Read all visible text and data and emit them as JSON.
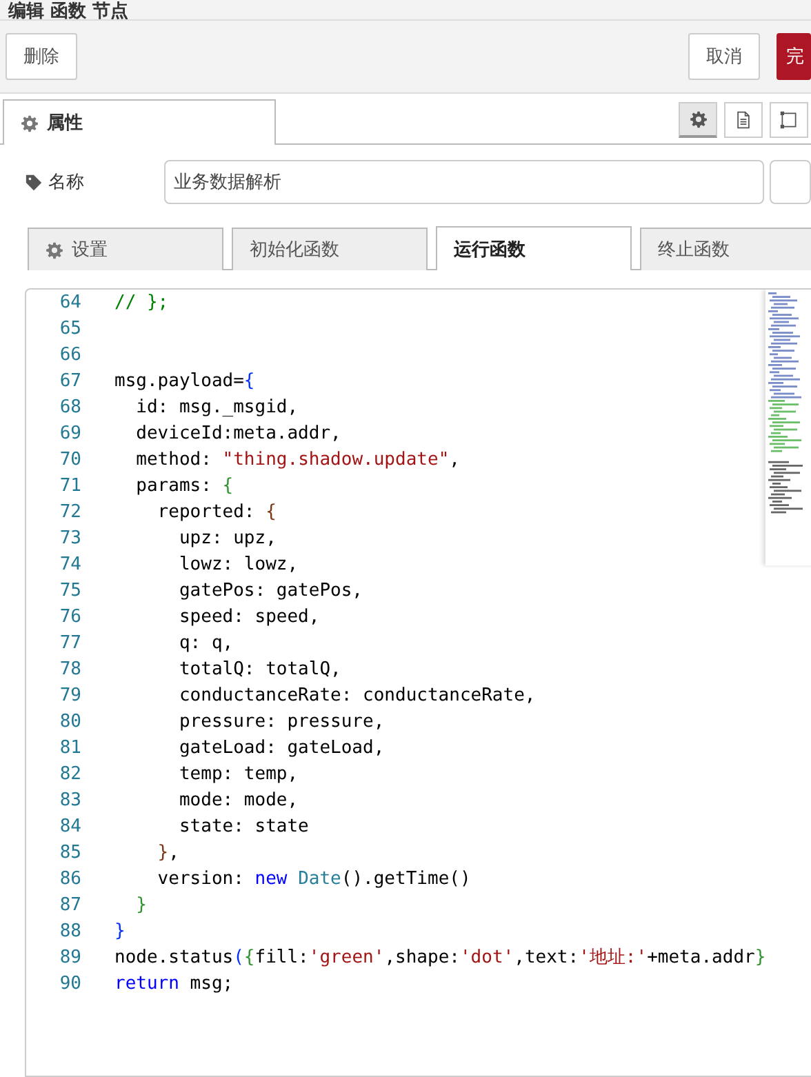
{
  "dialog": {
    "title": "编辑 函数 节点"
  },
  "toolbar": {
    "buttons": [
      {
        "label": "删除",
        "kind": "plain"
      },
      {
        "label": "取消",
        "kind": "plain"
      },
      {
        "label": "完",
        "kind": "primary"
      }
    ]
  },
  "tabs": [
    {
      "label": "属性",
      "selected": true
    }
  ],
  "tab_tools": [
    {
      "kind": "gear",
      "selected": true
    },
    {
      "kind": "doc",
      "selected": false
    },
    {
      "kind": "frame",
      "selected": false
    }
  ],
  "name_field": {
    "label": "名称",
    "value": "业务数据解析"
  },
  "sub_tabs": [
    {
      "label": "设置",
      "kind": "gear",
      "selected": false
    },
    {
      "label": "初始化函数",
      "kind": "plain",
      "selected": false
    },
    {
      "label": "运行函数",
      "kind": "plain",
      "selected": true
    },
    {
      "label": "终止函数",
      "kind": "plain",
      "selected": false
    }
  ],
  "editor": {
    "lines": [
      {
        "number": "64",
        "tokens": [
          {
            "kind": "comment",
            "text": "// };"
          }
        ]
      },
      {
        "number": "65"
      },
      {
        "number": "66"
      },
      {
        "number": "67",
        "tokens": [
          {
            "kind": "plain",
            "text": "msg.payload="
          },
          {
            "kind": "brace",
            "text": "{"
          }
        ]
      },
      {
        "number": "68",
        "tokens": [
          {
            "kind": "plain",
            "text": "  id: msg._msgid,"
          }
        ]
      },
      {
        "number": "69",
        "tokens": [
          {
            "kind": "plain",
            "text": "  deviceId:meta.addr,"
          }
        ]
      },
      {
        "number": "70",
        "tokens": [
          {
            "kind": "plain",
            "text": "  method: "
          },
          {
            "kind": "string",
            "text": "\"thing.shadow.update\""
          },
          {
            "kind": "plain",
            "text": ","
          }
        ]
      },
      {
        "number": "71",
        "tokens": [
          {
            "kind": "plain",
            "text": "  params: "
          },
          {
            "kind": "brace2",
            "text": "{"
          }
        ]
      },
      {
        "number": "72",
        "tokens": [
          {
            "kind": "plain",
            "text": "    reported: "
          },
          {
            "kind": "brace3",
            "text": "{"
          }
        ]
      },
      {
        "number": "73",
        "tokens": [
          {
            "kind": "plain",
            "text": "      upz: upz,"
          }
        ]
      },
      {
        "number": "74",
        "tokens": [
          {
            "kind": "plain",
            "text": "      lowz: lowz,"
          }
        ]
      },
      {
        "number": "75",
        "tokens": [
          {
            "kind": "plain",
            "text": "      gatePos: gatePos,"
          }
        ]
      },
      {
        "number": "76",
        "tokens": [
          {
            "kind": "plain",
            "text": "      speed: speed,"
          }
        ]
      },
      {
        "number": "77",
        "tokens": [
          {
            "kind": "plain",
            "text": "      q: q,"
          }
        ]
      },
      {
        "number": "78",
        "tokens": [
          {
            "kind": "plain",
            "text": "      totalQ: totalQ,"
          }
        ]
      },
      {
        "number": "79",
        "tokens": [
          {
            "kind": "plain",
            "text": "      conductanceRate: conductanceRate,"
          }
        ]
      },
      {
        "number": "80",
        "tokens": [
          {
            "kind": "plain",
            "text": "      pressure: pressure,"
          }
        ]
      },
      {
        "number": "81",
        "tokens": [
          {
            "kind": "plain",
            "text": "      gateLoad: gateLoad,"
          }
        ]
      },
      {
        "number": "82",
        "tokens": [
          {
            "kind": "plain",
            "text": "      temp: temp,"
          }
        ]
      },
      {
        "number": "83",
        "tokens": [
          {
            "kind": "plain",
            "text": "      mode: mode,"
          }
        ]
      },
      {
        "number": "84",
        "tokens": [
          {
            "kind": "plain",
            "text": "      state: state"
          }
        ]
      },
      {
        "number": "85",
        "tokens": [
          {
            "kind": "brace3",
            "text": "    }"
          },
          {
            "kind": "plain",
            "text": ","
          }
        ]
      },
      {
        "number": "86",
        "tokens": [
          {
            "kind": "plain",
            "text": "    version: "
          },
          {
            "kind": "keyword",
            "text": "new "
          },
          {
            "kind": "type",
            "text": "Date"
          },
          {
            "kind": "plain",
            "text": "().getTime()"
          }
        ]
      },
      {
        "number": "87",
        "tokens": [
          {
            "kind": "brace2",
            "text": "  }"
          }
        ]
      },
      {
        "number": "88",
        "tokens": [
          {
            "kind": "brace",
            "text": "}"
          }
        ]
      },
      {
        "number": "89",
        "tokens": [
          {
            "kind": "plain",
            "text": "node.status"
          },
          {
            "kind": "brace",
            "text": "("
          },
          {
            "kind": "brace2",
            "text": "{"
          },
          {
            "kind": "plain",
            "text": "fill:"
          },
          {
            "kind": "string",
            "text": "'green'"
          },
          {
            "kind": "plain",
            "text": ",shape:"
          },
          {
            "kind": "string",
            "text": "'dot'"
          },
          {
            "kind": "plain",
            "text": ",text:"
          },
          {
            "kind": "string",
            "text": "'地址:'"
          },
          {
            "kind": "plain",
            "text": "+meta.addr"
          },
          {
            "kind": "brace2",
            "text": "}"
          }
        ]
      },
      {
        "number": "90",
        "tokens": [
          {
            "kind": "keyword",
            "text": "return"
          },
          {
            "kind": "plain",
            "text": " msg;"
          }
        ]
      }
    ]
  }
}
